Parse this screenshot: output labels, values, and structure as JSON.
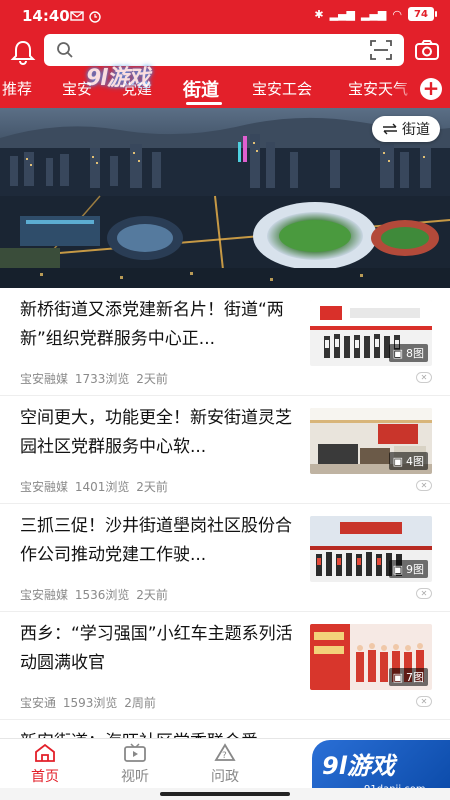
{
  "status_bar": {
    "time": "14:40",
    "battery": "74"
  },
  "search": {
    "placeholder": "",
    "value": ""
  },
  "tabs": [
    {
      "label": "推荐"
    },
    {
      "label": "宝安"
    },
    {
      "label": "党建"
    },
    {
      "label": "街道"
    },
    {
      "label": "宝安工会"
    },
    {
      "label": "宝安天气"
    }
  ],
  "active_tab": "街道",
  "watermark_logo": "9l游戏",
  "banner": {
    "switch_label": "街道"
  },
  "news": [
    {
      "title": "新桥街道又添党建新名片！街道“两新”组织党群服务中心正...",
      "source": "宝安融媒",
      "views": "1733浏览",
      "time": "2天前",
      "image_count": "8图"
    },
    {
      "title": "空间更大，功能更全！新安街道灵芝园社区党群服务中心软...",
      "source": "宝安融媒",
      "views": "1401浏览",
      "time": "2天前",
      "image_count": "4图"
    },
    {
      "title": "三抓三促！沙井街道壆岗社区股份合作公司推动党建工作驶...",
      "source": "宝安融媒",
      "views": "1536浏览",
      "time": "2天前",
      "image_count": "9图"
    },
    {
      "title": "西乡：“学习强国”小红车主题系列活动圆满收官",
      "source": "宝安通",
      "views": "1593浏览",
      "time": "2周前",
      "image_count": "7图"
    },
    {
      "title": "新安街道：海旺社区党委联合爱",
      "source": "",
      "views": "",
      "time": "",
      "image_count": ""
    }
  ],
  "bottom_nav": [
    {
      "label": "首页",
      "icon": "home-icon"
    },
    {
      "label": "视听",
      "icon": "video-icon"
    },
    {
      "label": "问政",
      "icon": "question-icon"
    }
  ],
  "watermark": {
    "logo": "9l游戏",
    "url": "91danji.com"
  },
  "colors": {
    "brand_red": "#e3202a",
    "text": "#111111",
    "meta": "#8a8a8a"
  }
}
